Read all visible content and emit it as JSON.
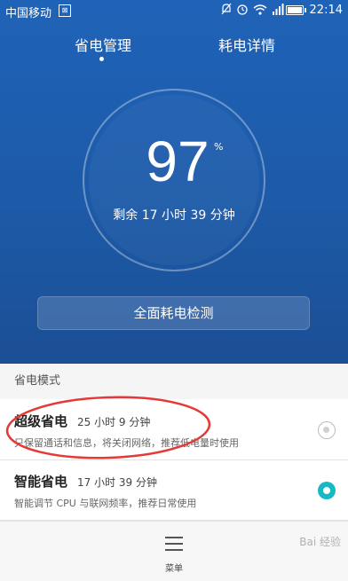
{
  "status_bar": {
    "carrier": "中国移动",
    "carrier_icon": "⊠",
    "time": "22:14",
    "icons": [
      "mute-icon",
      "alarm-icon",
      "wifi-icon",
      "signal-icon",
      "battery-icon"
    ],
    "battery_level": 0.97
  },
  "tabs": [
    {
      "label": "省电管理",
      "active": true
    },
    {
      "label": "耗电详情",
      "active": false
    }
  ],
  "battery": {
    "percent": "97",
    "percent_sign": "%",
    "remaining": "剩余 17 小时 39 分钟"
  },
  "check_button": {
    "label": "全面耗电检测"
  },
  "section": {
    "title": "省电模式"
  },
  "modes": [
    {
      "name": "超级省电",
      "time": "25 小时 9 分钟",
      "desc": "只保留通话和信息，将关闭网络，推荐低电量时使用",
      "selected": false
    },
    {
      "name": "智能省电",
      "time": "17 小时 39 分钟",
      "desc": "智能调节 CPU 与联网频率，推荐日常使用",
      "selected": true
    }
  ],
  "bottom": {
    "menu_label": "菜单",
    "watermark": "Bai 经验"
  },
  "colors": {
    "header": "#1f63b8",
    "accent": "#16b9c4",
    "annotation": "#e53935"
  }
}
